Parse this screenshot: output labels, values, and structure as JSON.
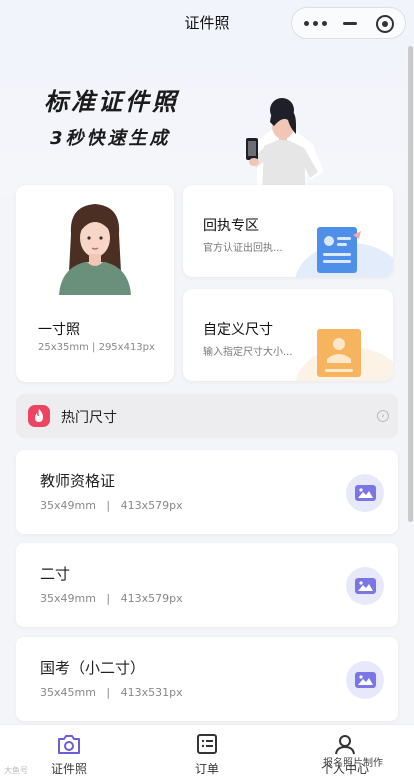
{
  "header": {
    "title": "证件照"
  },
  "banner": {
    "headline": "标准证件照",
    "subline": "3秒快速生成"
  },
  "cards": {
    "one_inch": {
      "name": "一寸照",
      "spec": "25x35mm | 295x413px"
    },
    "receipt": {
      "name": "回执专区",
      "desc": "官方认证出回执..."
    },
    "custom": {
      "name": "自定义尺寸",
      "desc": "输入指定尺寸大小..."
    }
  },
  "hot": {
    "label": "热门尺寸"
  },
  "sizes": [
    {
      "name": "教师资格证",
      "spec": "35x49mm   |   413x579px"
    },
    {
      "name": "二寸",
      "spec": "35x49mm   |   413x579px"
    },
    {
      "name": "国考（小二寸）",
      "spec": "35x45mm   |   413x531px"
    }
  ],
  "tabbar": {
    "photo": "证件照",
    "orders": "订单",
    "me": "个人中心"
  },
  "watermark": {
    "left": "大鱼号",
    "right": "报名照片制作"
  },
  "colors": {
    "accent": "#7a76e6",
    "hot": "#ee4461",
    "receipt_blue": "#4e8fea",
    "custom_orange": "#f5b45d"
  }
}
